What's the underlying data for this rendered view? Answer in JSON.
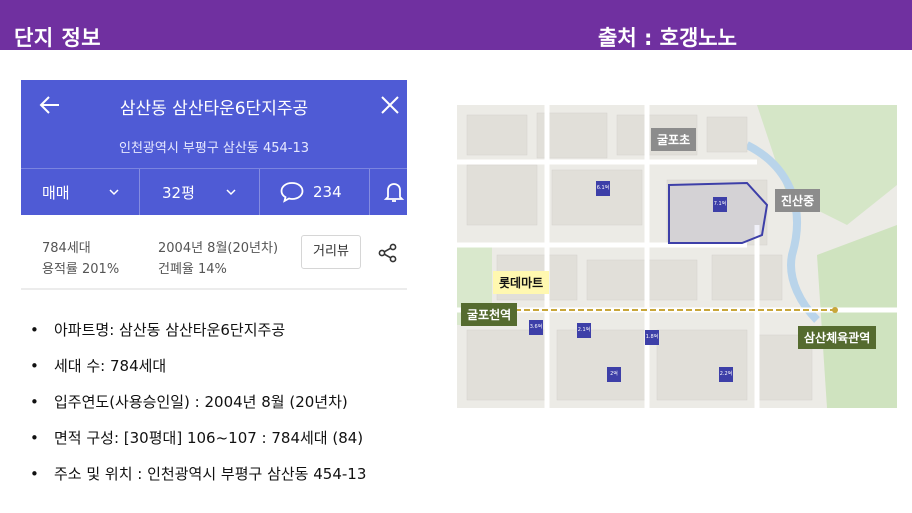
{
  "slide": {
    "title": "단지 정보",
    "source": "출처 : 호갱노노"
  },
  "app": {
    "complex_name": "삼산동 삼산타운6단지주공",
    "address": "인천광역시 부평구 삼산동 454-13",
    "filters": {
      "trade_type": "매매",
      "size": "32평",
      "comment_count": "234"
    },
    "info": {
      "households": "784세대",
      "floor_area_ratio": "용적률 201%",
      "built": "2004년 8월(20년차)",
      "coverage_ratio": "건폐율 14%"
    },
    "road_view_button": "거리뷰",
    "accent_color": "#4f5bd5"
  },
  "bullets": [
    "아파트명: 삼산동 삼산타운6단지주공",
    "세대 수: 784세대",
    "입주연도(사용승인일) : 2004년 8월 (20년차)",
    "면적 구성: [30평대] 106~107 : 784세대 (84)",
    "주소   및 위치 : 인천광역시 부평구 삼산동 454-13"
  ],
  "map": {
    "labels": {
      "gulpo_elementary": "굴포초",
      "jinsan_middle": "진산중",
      "lotte_mart": "롯데마트",
      "gulpocheon_station": "굴포천역",
      "samsan_gym_station": "삼산체육관역"
    },
    "pins": [
      "6.1억",
      "7.1억",
      "3.6억",
      "2.1억",
      "1.8억",
      "2억",
      "2.2억"
    ]
  },
  "theme": {
    "header_color": "#7030a0"
  }
}
